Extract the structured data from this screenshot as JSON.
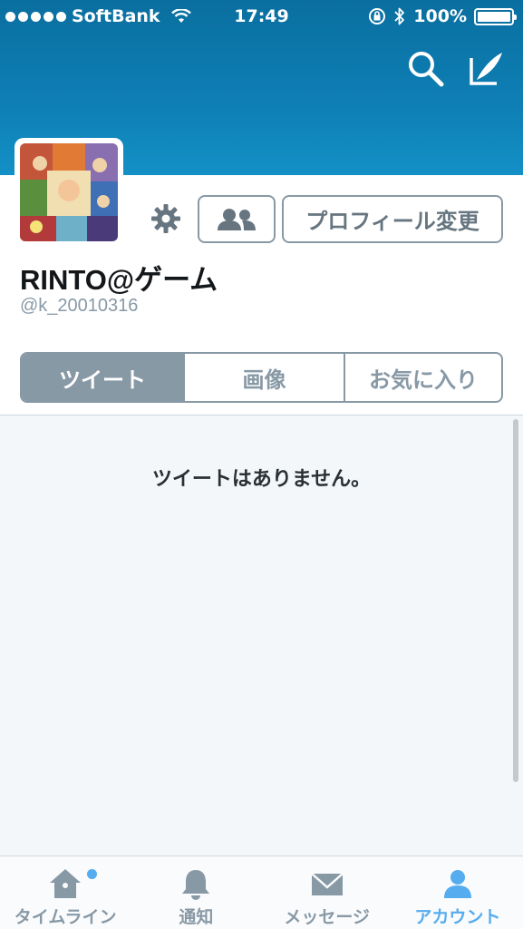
{
  "status_bar": {
    "carrier": "SoftBank",
    "time": "17:49",
    "battery": "100%"
  },
  "header": {
    "search_icon": "search-icon",
    "compose_icon": "compose-tweet-icon"
  },
  "profile": {
    "display_name": "RINTO@ゲーム",
    "handle": "@k_20010316",
    "edit_profile_label": "プロフィール変更",
    "follow_icon": "people-icon",
    "settings_icon": "gear-icon"
  },
  "segments": [
    {
      "label": "ツイート",
      "active": true
    },
    {
      "label": "画像",
      "active": false
    },
    {
      "label": "お気に入り",
      "active": false
    }
  ],
  "content": {
    "empty_message": "ツイートはありません。"
  },
  "tabbar": [
    {
      "label": "タイムライン",
      "icon": "home-icon",
      "active": false,
      "badge": true
    },
    {
      "label": "通知",
      "icon": "bell-icon",
      "active": false,
      "badge": false
    },
    {
      "label": "メッセージ",
      "icon": "envelope-icon",
      "active": false,
      "badge": false
    },
    {
      "label": "アカウント",
      "icon": "person-icon",
      "active": true,
      "badge": false
    }
  ],
  "colors": {
    "banner": "#0e7fb5",
    "accent": "#55acee",
    "muted": "#8899a6"
  }
}
